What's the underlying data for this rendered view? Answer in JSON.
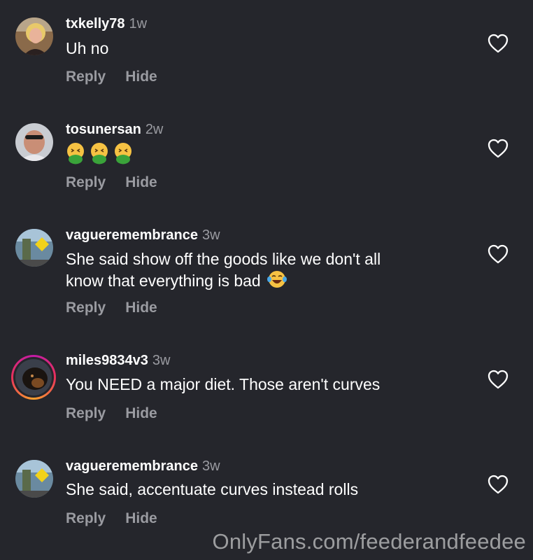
{
  "comments": [
    {
      "username": "txkelly78",
      "time": "1w",
      "text": "Uh no",
      "reply_label": "Reply",
      "hide_label": "Hide",
      "avatar_icon": "profile-photo-woman-blonde"
    },
    {
      "username": "tosunersan",
      "time": "2w",
      "text": "",
      "emoji_icons": [
        "nauseated-face-icon",
        "nauseated-face-icon",
        "nauseated-face-icon"
      ],
      "reply_label": "Reply",
      "hide_label": "Hide",
      "avatar_icon": "profile-photo-man-sunglasses"
    },
    {
      "username": "vagueremembrance",
      "time": "3w",
      "text_line1": "She said show off the goods like we don't all",
      "text_line2": "know that everything is bad",
      "trailing_emoji": "tears-of-joy-icon",
      "reply_label": "Reply",
      "hide_label": "Hide",
      "avatar_icon": "profile-photo-yellow-sign"
    },
    {
      "username": "miles9834v3",
      "time": "3w",
      "text": "You NEED a major diet. Those aren't curves",
      "reply_label": "Reply",
      "hide_label": "Hide",
      "avatar_icon": "profile-photo-dog",
      "has_story_ring": true
    },
    {
      "username": "vagueremembrance",
      "time": "3w",
      "text": "She said, accentuate curves instead rolls",
      "reply_label": "Reply",
      "hide_label": "Hide",
      "avatar_icon": "profile-photo-yellow-sign"
    }
  ],
  "watermark": "OnlyFans.com/feederandfeedee",
  "colors": {
    "background": "#25262c",
    "muted_text": "#9a9ba1",
    "primary_text": "#ffffff",
    "story_ring": "#e8315a"
  }
}
